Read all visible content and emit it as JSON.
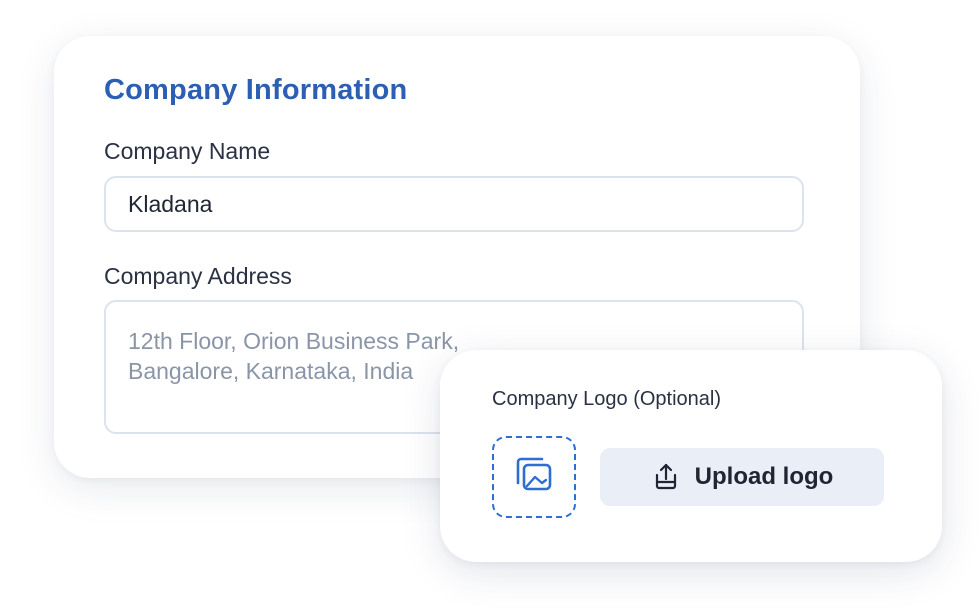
{
  "company_info": {
    "title": "Company Information",
    "name_label": "Company Name",
    "name_value": "Kladana",
    "address_label": "Company Address",
    "address_placeholder": "12th Floor, Orion Business Park,\nBangalore, Karnataka, India"
  },
  "logo_card": {
    "label": "Company Logo (Optional)",
    "dropzone_icon": "image-gallery-icon",
    "upload_icon": "upload-icon",
    "upload_button_label": "Upload logo"
  },
  "colors": {
    "accent": "#2c5fb3",
    "dropzone_border": "#2c6fd1",
    "button_bg": "#e9eef7",
    "input_border": "#dde3ec"
  }
}
